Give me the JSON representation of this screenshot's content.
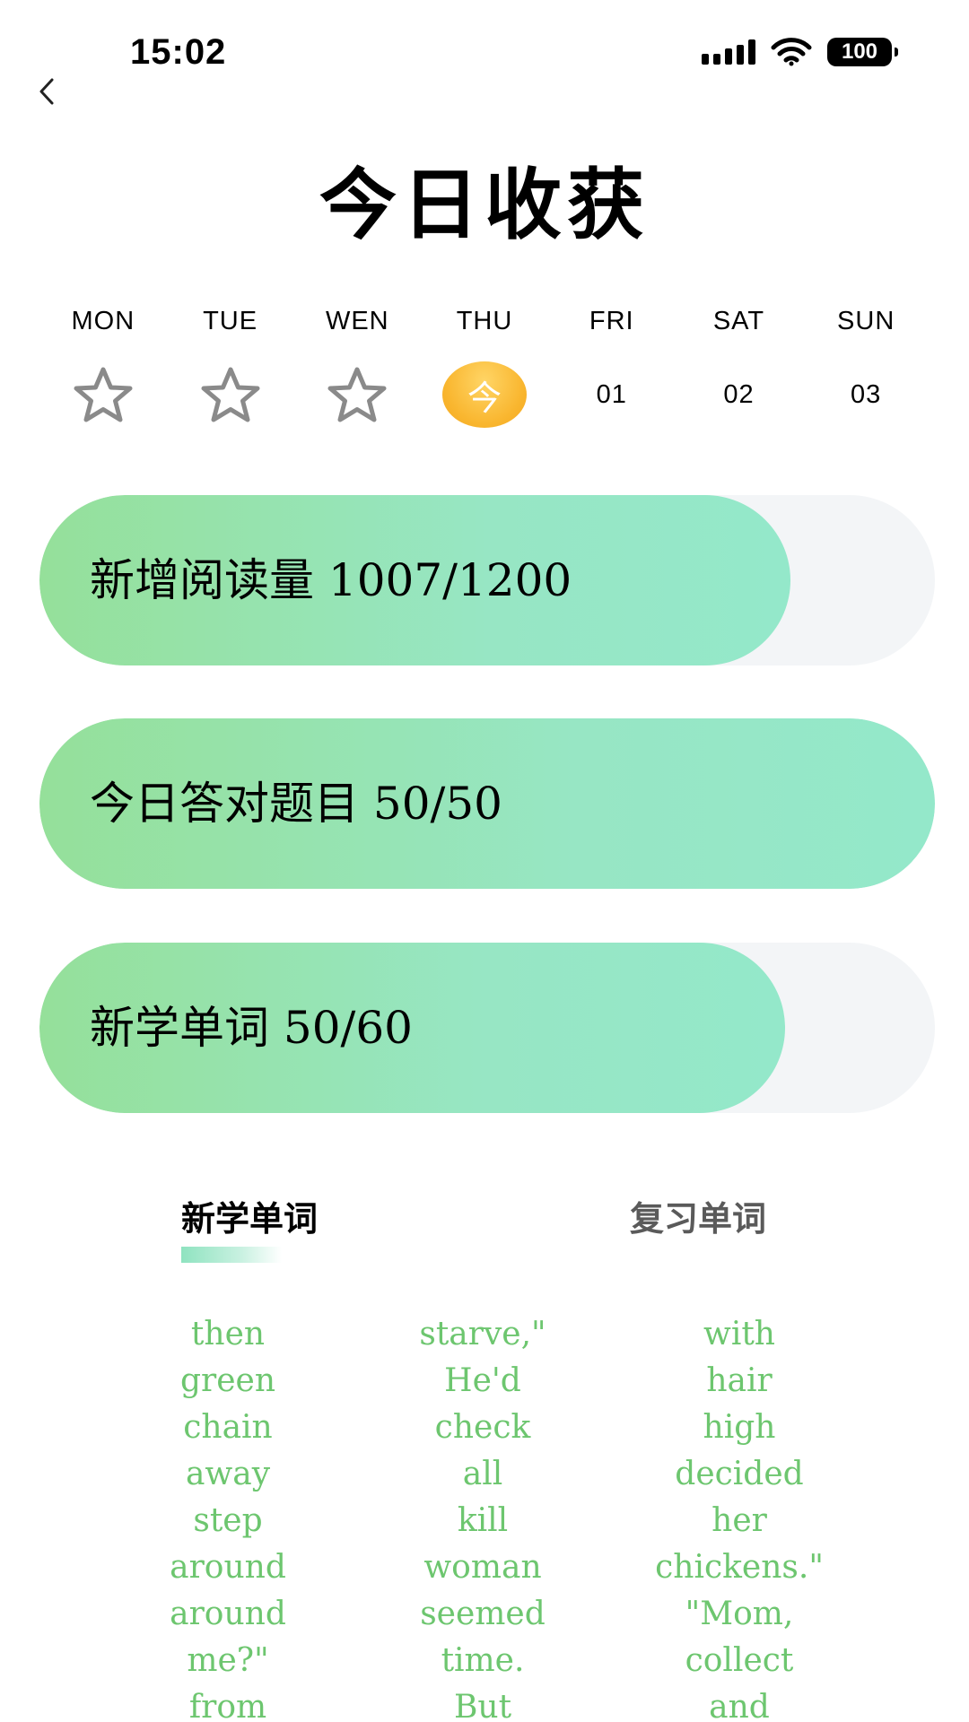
{
  "status_bar": {
    "time": "15:02",
    "battery": "100",
    "icons": [
      "signal-icon",
      "wifi-icon",
      "battery-icon"
    ]
  },
  "header": {
    "back_icon": "chevron-left-icon",
    "title": "今日收获"
  },
  "week": {
    "days": [
      {
        "label": "MON",
        "mark": "star"
      },
      {
        "label": "TUE",
        "mark": "star"
      },
      {
        "label": "WEN",
        "mark": "star"
      },
      {
        "label": "THU",
        "mark": "今"
      },
      {
        "label": "FRI",
        "mark": "01"
      },
      {
        "label": "SAT",
        "mark": "02"
      },
      {
        "label": "SUN",
        "mark": "03"
      }
    ]
  },
  "progress": [
    {
      "text": "新增阅读量 1007/1200",
      "fraction": 0.839
    },
    {
      "text": "今日答对题目 50/50",
      "fraction": 1.0
    },
    {
      "text": "新学单词 50/60",
      "fraction": 0.833
    }
  ],
  "tabs": {
    "new_words": "新学单词",
    "review_words": "复习单词"
  },
  "words": {
    "col1": [
      "then",
      "green",
      "chain",
      "away",
      "step",
      "around",
      "around",
      "me?\"",
      "from"
    ],
    "col2": [
      "starve,\"",
      "He'd",
      "check",
      "all",
      "kill",
      "woman",
      "seemed",
      "time.",
      "But"
    ],
    "col3": [
      "with",
      "hair",
      "high",
      "decided",
      "her",
      "chickens.\"",
      "\"Mom,",
      "collect",
      "and"
    ]
  },
  "colors": {
    "accent_green": "#6dc66f",
    "progress_start": "#95e09a",
    "progress_end": "#94e8ca",
    "track": "#f3f5f7",
    "today": "#f9b62f"
  }
}
